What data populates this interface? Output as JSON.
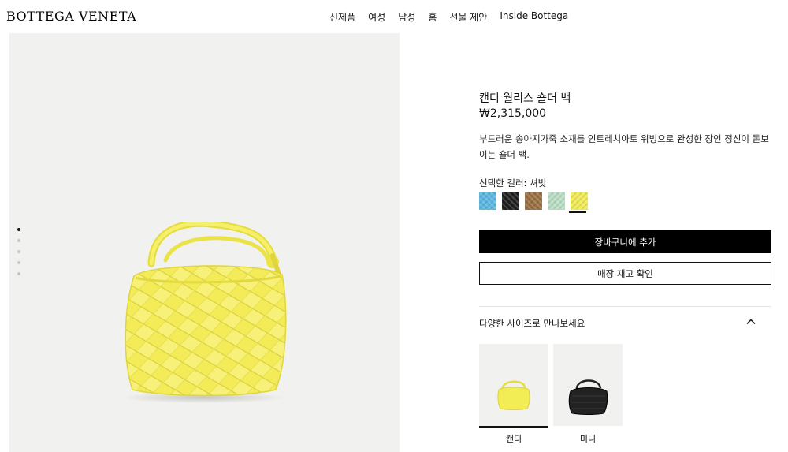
{
  "brand": {
    "logo": "BOTTEGA VENETA"
  },
  "nav": {
    "items": [
      "신제품",
      "여성",
      "남성",
      "홈",
      "선물 제안",
      "Inside Bottega"
    ]
  },
  "gallery": {
    "slides": 5,
    "active_slide": 1,
    "background": "#f1f1ef"
  },
  "product": {
    "title": "캔디 월리스 숄더 백",
    "price": "₩2,315,000",
    "description": "부드러운 송아지가죽 소재를 인트레치아토 위빙으로 완성한 장인 정신이 돋보이는 숄더 백.",
    "color_label": "선택한 컬러: 셔벗",
    "swatches": [
      {
        "color": "#5ab8e2",
        "selected": false
      },
      {
        "color": "#1e1e1e",
        "selected": false
      },
      {
        "color": "#9a7043",
        "selected": false
      },
      {
        "color": "#b9dfc5",
        "selected": false
      },
      {
        "color": "#f2ec55",
        "selected": true
      }
    ],
    "add_to_cart": "장바구니에 추가",
    "check_store": "매장 재고 확인",
    "sizes_title": "다양한 사이즈로 만나보세요",
    "sizes": [
      {
        "label": "캔디",
        "selected": true,
        "bag_color": "#f2ec55"
      },
      {
        "label": "미니",
        "selected": false,
        "bag_color": "#222222"
      }
    ]
  },
  "colors": {
    "accent": "#000000",
    "bag_yellow": "#f2ec55"
  },
  "icons": {
    "size_toggle": "chevron-up-icon"
  }
}
